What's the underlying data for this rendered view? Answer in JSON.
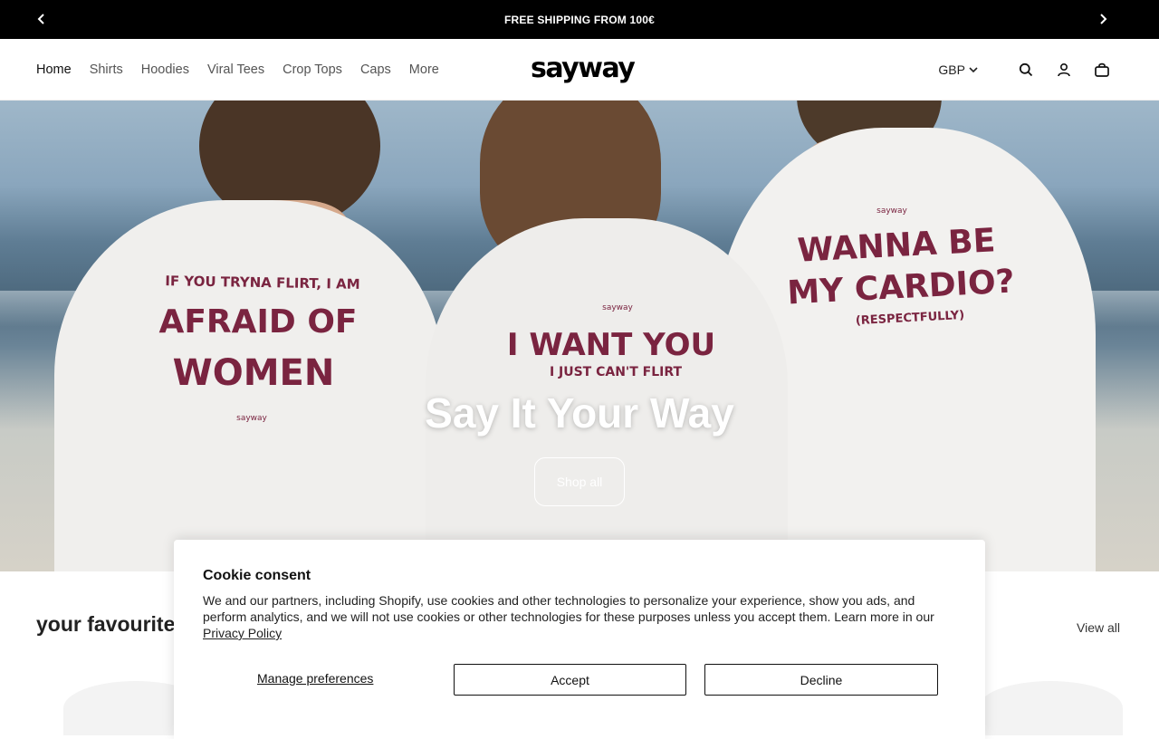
{
  "announcement": {
    "text": "FREE SHIPPING FROM 100€",
    "prev_icon": "chevron-left-icon",
    "next_icon": "chevron-right-icon"
  },
  "nav": {
    "items": [
      {
        "label": "Home",
        "active": true
      },
      {
        "label": "Shirts"
      },
      {
        "label": "Hoodies"
      },
      {
        "label": "Viral Tees"
      },
      {
        "label": "Crop Tops"
      },
      {
        "label": "Caps"
      },
      {
        "label": "More"
      }
    ]
  },
  "brand": {
    "logo_text": "sayway"
  },
  "header_tools": {
    "currency": "GBP",
    "icons": [
      "search-icon",
      "account-icon",
      "cart-icon"
    ]
  },
  "hero": {
    "shirt_1": {
      "top": "IF YOU TRYNA FLIRT, I AM",
      "line1": "AFRAID OF",
      "line2": "WOMEN",
      "tag": "sayway"
    },
    "shirt_2": {
      "tag": "sayway",
      "line1": "I WANT YOU",
      "line2": "I JUST CAN'T FLIRT"
    },
    "shirt_3": {
      "tag": "sayway",
      "line1": "WANNA BE",
      "line2": "MY CARDIO?",
      "line3": "(RESPECTFULLY)"
    },
    "title": "Say It Your Way",
    "button": "Shop all"
  },
  "featured": {
    "title": "your favourite",
    "view_all": "View all"
  },
  "cookie": {
    "title": "Cookie consent",
    "body": "We and our partners, including Shopify, use cookies and other technologies to personalize your experience, show you ads, and perform analytics, and we will not use cookies or other technologies for these purposes unless you accept them. Learn more in our ",
    "link": "Privacy Policy",
    "manage": "Manage preferences",
    "accept": "Accept",
    "decline": "Decline"
  },
  "colors": {
    "announcement_bg": "#000000",
    "shirt_print": "#7a2440"
  }
}
